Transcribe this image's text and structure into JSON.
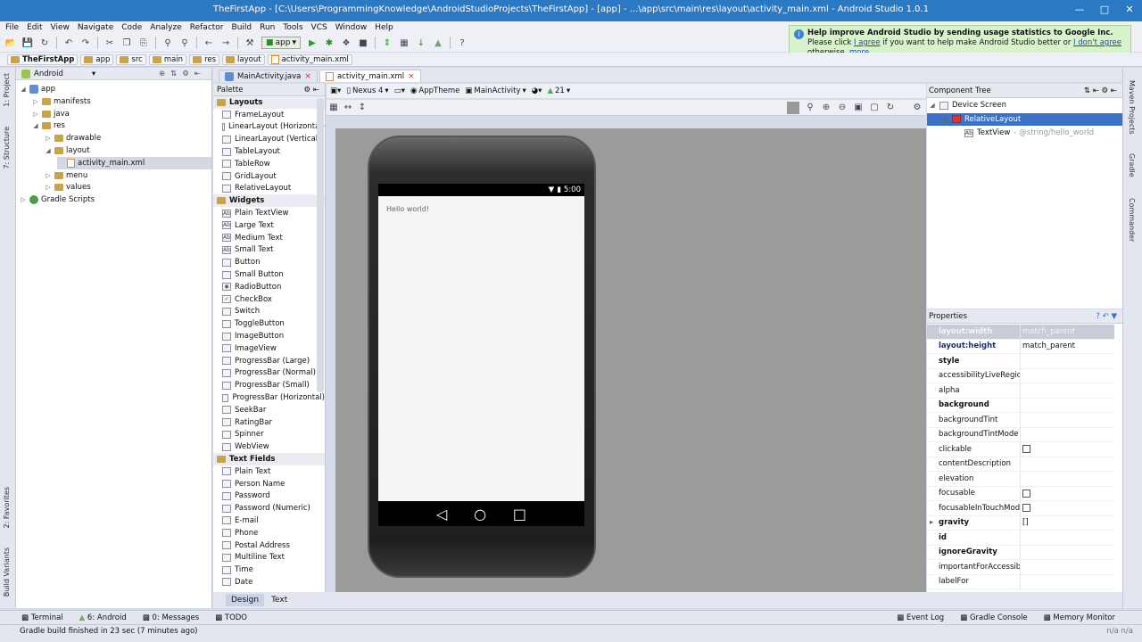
{
  "window": {
    "title": "TheFirstApp - [C:\\Users\\ProgrammingKnowledge\\AndroidStudioProjects\\TheFirstApp] - [app] - ...\\app\\src\\main\\res\\layout\\activity_main.xml - Android Studio 1.0.1"
  },
  "menu": [
    "File",
    "Edit",
    "View",
    "Navigate",
    "Code",
    "Analyze",
    "Refactor",
    "Build",
    "Run",
    "Tools",
    "VCS",
    "Window",
    "Help"
  ],
  "toolbar": {
    "run_config": "app"
  },
  "breadcrumbs": [
    "TheFirstApp",
    "app",
    "src",
    "main",
    "res",
    "layout",
    "activity_main.xml"
  ],
  "project": {
    "view": "Android",
    "tree": [
      {
        "label": "app",
        "depth": 0,
        "expanded": true
      },
      {
        "label": "manifests",
        "depth": 1,
        "expanded": false
      },
      {
        "label": "java",
        "depth": 1,
        "expanded": false
      },
      {
        "label": "res",
        "depth": 1,
        "expanded": true
      },
      {
        "label": "drawable",
        "depth": 2,
        "expanded": false
      },
      {
        "label": "layout",
        "depth": 2,
        "expanded": true
      },
      {
        "label": "activity_main.xml",
        "depth": 3,
        "selected": true
      },
      {
        "label": "menu",
        "depth": 2,
        "expanded": false
      },
      {
        "label": "values",
        "depth": 2,
        "expanded": false
      },
      {
        "label": "Gradle Scripts",
        "depth": 0,
        "expanded": false
      }
    ]
  },
  "editor_tabs": [
    {
      "label": "MainActivity.java",
      "active": false
    },
    {
      "label": "activity_main.xml",
      "active": true
    }
  ],
  "palette": {
    "title": "Palette",
    "groups": [
      {
        "name": "Layouts",
        "items": [
          "FrameLayout",
          "LinearLayout (Horizontal)",
          "LinearLayout (Vertical)",
          "TableLayout",
          "TableRow",
          "GridLayout",
          "RelativeLayout"
        ]
      },
      {
        "name": "Widgets",
        "items": [
          "Plain TextView",
          "Large Text",
          "Medium Text",
          "Small Text",
          "Button",
          "Small Button",
          "RadioButton",
          "CheckBox",
          "Switch",
          "ToggleButton",
          "ImageButton",
          "ImageView",
          "ProgressBar (Large)",
          "ProgressBar (Normal)",
          "ProgressBar (Small)",
          "ProgressBar (Horizontal)",
          "SeekBar",
          "RatingBar",
          "Spinner",
          "WebView"
        ]
      },
      {
        "name": "Text Fields",
        "items": [
          "Plain Text",
          "Person Name",
          "Password",
          "Password (Numeric)",
          "E-mail",
          "Phone",
          "Postal Address",
          "Multiline Text",
          "Time",
          "Date"
        ]
      }
    ]
  },
  "design_toolbar": {
    "device": "Nexus 4",
    "theme": "AppTheme",
    "activity": "MainActivity",
    "api": "21"
  },
  "phone": {
    "time": "5:00",
    "text": "Hello world!"
  },
  "component_tree": {
    "title": "Component Tree",
    "rows": [
      {
        "label": "Device Screen",
        "depth": 0
      },
      {
        "label": "RelativeLayout",
        "depth": 1,
        "selected": true
      },
      {
        "label": "TextView",
        "hint": "- @string/hello_world",
        "depth": 2
      }
    ]
  },
  "properties": {
    "title": "Properties",
    "rows": [
      {
        "name": "layout:width",
        "value": "match_parent",
        "bold": true,
        "faded": true
      },
      {
        "name": "layout:height",
        "value": "match_parent",
        "bold": true
      },
      {
        "name": "style",
        "value": "",
        "bold": true
      },
      {
        "name": "accessibilityLiveRegion",
        "value": ""
      },
      {
        "name": "alpha",
        "value": ""
      },
      {
        "name": "background",
        "value": "",
        "bold": true
      },
      {
        "name": "backgroundTint",
        "value": ""
      },
      {
        "name": "backgroundTintMode",
        "value": ""
      },
      {
        "name": "clickable",
        "value": "",
        "checkbox": true
      },
      {
        "name": "contentDescription",
        "value": ""
      },
      {
        "name": "elevation",
        "value": ""
      },
      {
        "name": "focusable",
        "value": "",
        "checkbox": true
      },
      {
        "name": "focusableInTouchMode",
        "value": "",
        "checkbox": true
      },
      {
        "name": "gravity",
        "value": "[]",
        "bold": true,
        "expandable": true
      },
      {
        "name": "id",
        "value": "",
        "bold": true
      },
      {
        "name": "ignoreGravity",
        "value": "",
        "bold": true
      },
      {
        "name": "importantForAccessibility",
        "value": ""
      },
      {
        "name": "labelFor",
        "value": ""
      }
    ]
  },
  "notification": {
    "title": "Help improve Android Studio by sending usage statistics to Google Inc.",
    "line2_pre": "Please click ",
    "agree": "I agree",
    "line2_mid": " if you want to help make Android Studio better or ",
    "disagree": "I don't agree",
    "line3_pre": "otherwise. ",
    "more": "more..."
  },
  "design_tabs": [
    "Design",
    "Text"
  ],
  "tool_windows": {
    "left": [
      "Terminal",
      "6: Android",
      "0: Messages",
      "TODO"
    ],
    "right": [
      "Event Log",
      "Gradle Console",
      "Memory Monitor"
    ]
  },
  "status": {
    "message": "Gradle build finished in 23 sec (7 minutes ago)",
    "right": "n/a    n/a"
  },
  "side_tabs": {
    "left": [
      "1: Project",
      "7: Structure",
      "2: Favorites",
      "Build Variants"
    ],
    "right": [
      "Maven Projects",
      "Gradle",
      "Commander"
    ]
  }
}
